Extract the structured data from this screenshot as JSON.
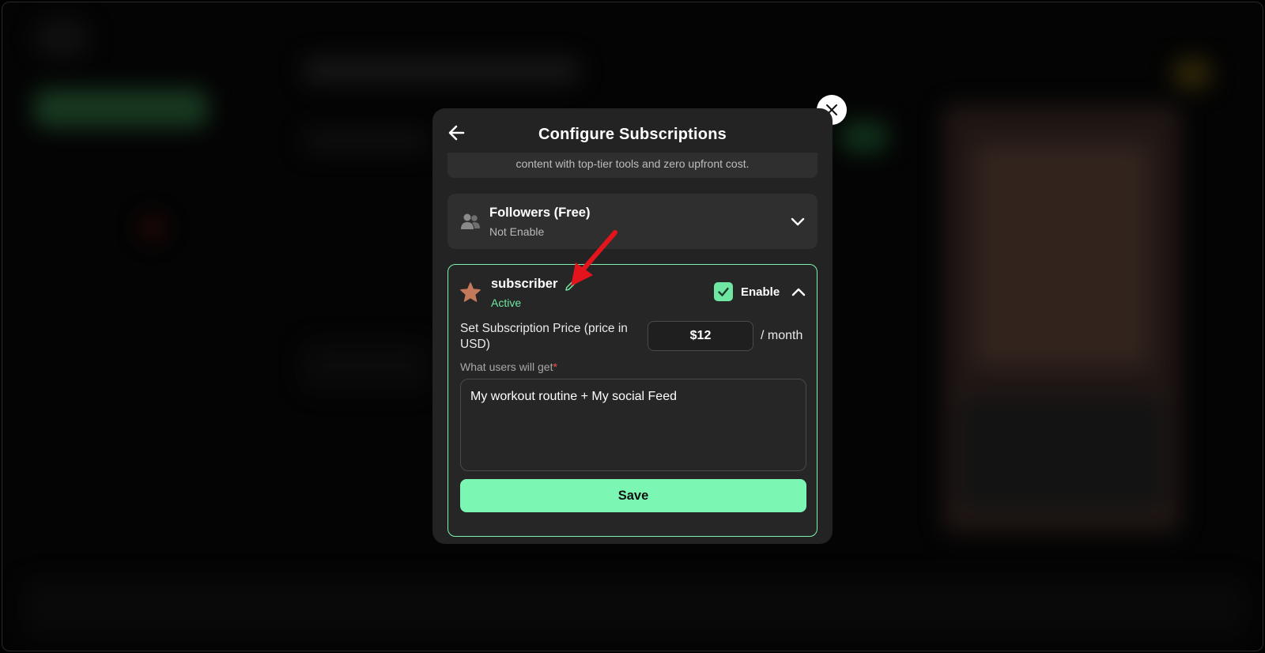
{
  "modal": {
    "title": "Configure Subscriptions",
    "intro_text": "content with top-tier tools and zero upfront cost."
  },
  "icons": {
    "back": "arrow-left-icon",
    "close": "close-icon",
    "followers": "users-icon",
    "subscriber": "star-icon",
    "edit": "pencil-icon",
    "check": "check-icon",
    "expand": "chevron-down-icon",
    "collapse": "chevron-up-icon"
  },
  "tiers": {
    "followers": {
      "title": "Followers (Free)",
      "status": "Not Enable"
    },
    "subscriber": {
      "title": "subscriber",
      "status": "Active",
      "enable_label": "Enable",
      "enabled": true,
      "price_label": "Set Subscription Price (price in USD)",
      "price_value": "$12",
      "price_unit": "/ month",
      "users_get_label": "What users will get",
      "users_get_required": "*",
      "users_get_value": "My workout routine + My social Feed",
      "save_label": "Save"
    }
  },
  "colors": {
    "accent": "#7cf7b3",
    "active_text": "#6fe7a3",
    "star": "#c47a5a",
    "annotation_arrow": "#e3141b",
    "modal_bg": "#232323"
  }
}
